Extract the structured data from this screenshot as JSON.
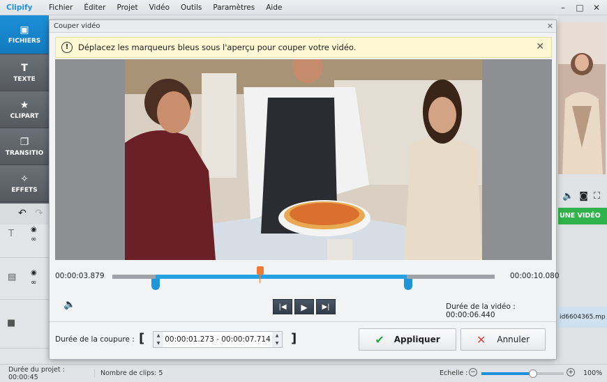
{
  "app": {
    "brand": "Clipify",
    "menu": [
      "Fichier",
      "Éditer",
      "Projet",
      "Vidéo",
      "Outils",
      "Paramètres",
      "Aide"
    ],
    "window_controls": [
      "–",
      "□",
      "✕"
    ]
  },
  "left_tabs": [
    {
      "label": "FICHIERS",
      "icon": "image-icon"
    },
    {
      "label": "TEXTE",
      "icon": "text-icon"
    },
    {
      "label": "CLIPART",
      "icon": "star-icon"
    },
    {
      "label": "TRANSITIO",
      "icon": "transition-icon"
    },
    {
      "label": "EFFETS",
      "icon": "wand-icon"
    }
  ],
  "right_panel": {
    "add_video_label": "UNE VIDÉO",
    "clip_filename": "id6604365.mp"
  },
  "dialog": {
    "title": "Couper vidéo",
    "info_message": "Déplacez les marqueurs bleus sous l'aperçu pour couper votre vidéo.",
    "start_time": "00:00:03.879",
    "end_time": "00:00:10.080",
    "duration_label": "Durée de la vidéo : 00:00:06.440",
    "cut_duration_label": "Durée de la coupure :",
    "cut_range": "00:00:01.273 - 00:00:07.714",
    "apply_label": "Appliquer",
    "cancel_label": "Annuler",
    "selection_start_fraction": 0.113,
    "selection_end_fraction": 0.77,
    "playhead_fraction": 0.382
  },
  "status": {
    "project_duration": "Durée du projet : 00:00:45",
    "clip_count": "Nombre de clips: 5",
    "scale_label": "Echelle :",
    "zoom": "100%"
  },
  "colors": {
    "accent_blue": "#1b8fd9",
    "add_video_green": "#2fb34a",
    "playhead_orange": "#ee7b35",
    "info_bg": "#fdf7d3"
  }
}
